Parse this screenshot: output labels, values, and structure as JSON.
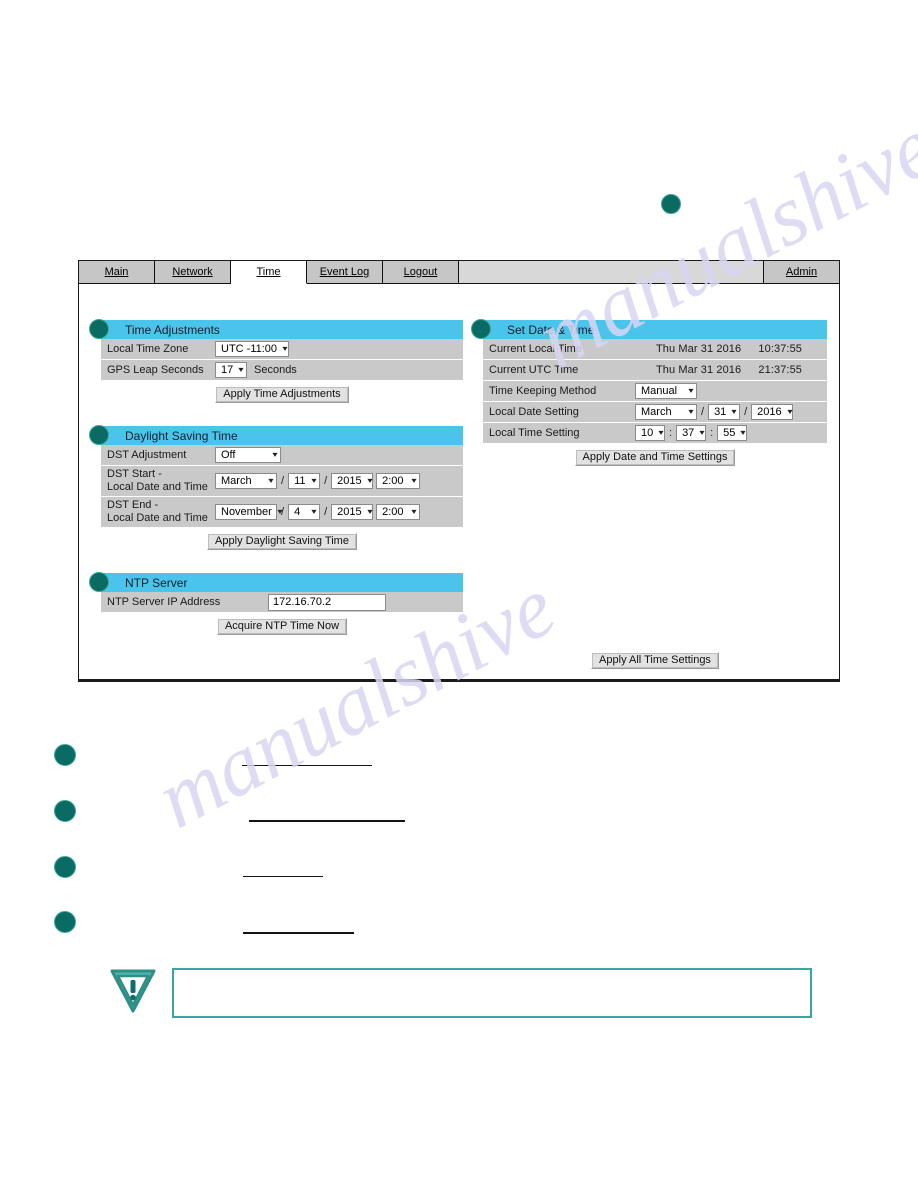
{
  "page": {
    "standalone_callout_marker": "●"
  },
  "browser_ui": {
    "tabs": [
      {
        "id": "main",
        "label": "Main",
        "active": false
      },
      {
        "id": "network",
        "label": "Network",
        "active": false
      },
      {
        "id": "time",
        "label": "Time",
        "active": true
      },
      {
        "id": "eventlog",
        "label": "Event Log",
        "active": false
      },
      {
        "id": "logout",
        "label": "Logout",
        "active": false
      }
    ],
    "admin_tab": {
      "id": "admin",
      "label": "Admin"
    }
  },
  "sections": {
    "time_adjustments": {
      "title": "Time Adjustments",
      "rows": {
        "local_time_zone": {
          "label": "Local Time Zone",
          "value": "UTC -11:00"
        },
        "gps_leap_seconds": {
          "label": "GPS Leap Seconds",
          "value": "17",
          "unit": "Seconds"
        }
      },
      "apply_button": "Apply Time Adjustments"
    },
    "daylight_saving_time": {
      "title": "Daylight Saving Time",
      "rows": {
        "dst_adjustment": {
          "label": "DST Adjustment",
          "value": "Off"
        },
        "dst_start": {
          "label": "DST Start -\nLocal Date and Time",
          "month": "March",
          "day": "11",
          "year": "2015",
          "time": "2:00"
        },
        "dst_end": {
          "label": "DST End -\nLocal Date and Time",
          "month": "November",
          "day": "4",
          "year": "2015",
          "time": "2:00"
        }
      },
      "separator": "/",
      "apply_button": "Apply Daylight Saving Time"
    },
    "ntp_server": {
      "title": "NTP Server",
      "rows": {
        "ntp_ip": {
          "label": "NTP Server IP Address",
          "value": "172.16.70.2"
        }
      },
      "acquire_button": "Acquire NTP Time Now"
    },
    "set_date_time": {
      "title": "Set Date & Time",
      "rows": {
        "current_local_time": {
          "label": "Current Local Time",
          "date": "Thu Mar 31 2016",
          "time": "10:37:55"
        },
        "current_utc_time": {
          "label": "Current UTC Time",
          "date": "Thu Mar 31 2016",
          "time": "21:37:55"
        },
        "time_keeping_method": {
          "label": "Time Keeping Method",
          "value": "Manual"
        },
        "local_date_setting": {
          "label": "Local Date Setting",
          "month": "March",
          "day": "31",
          "year": "2016"
        },
        "local_time_setting": {
          "label": "Local Time Setting",
          "hours": "10",
          "minutes": "37",
          "seconds": "55"
        }
      },
      "date_separator": "/",
      "time_separator": ":",
      "apply_button": "Apply Date and Time Settings"
    }
  },
  "footer": {
    "apply_all_button": "Apply All Time Settings"
  },
  "annotations": {
    "callout_dots": [
      {
        "id": "callout-1"
      },
      {
        "id": "callout-2"
      },
      {
        "id": "callout-3"
      },
      {
        "id": "callout-4"
      }
    ],
    "note_box": {
      "text": ""
    }
  },
  "colors": {
    "section_header": "#4bc4ec",
    "callout_dot_fill": "#0a6b63",
    "callout_dot_ring": "#3fa79b",
    "row_background": "#c9c9c9",
    "tab_background": "#c6c6c6",
    "note_border": "#3aa79f"
  },
  "watermark": {
    "line_a": "manualshive.com",
    "line_b": "manualshive"
  }
}
